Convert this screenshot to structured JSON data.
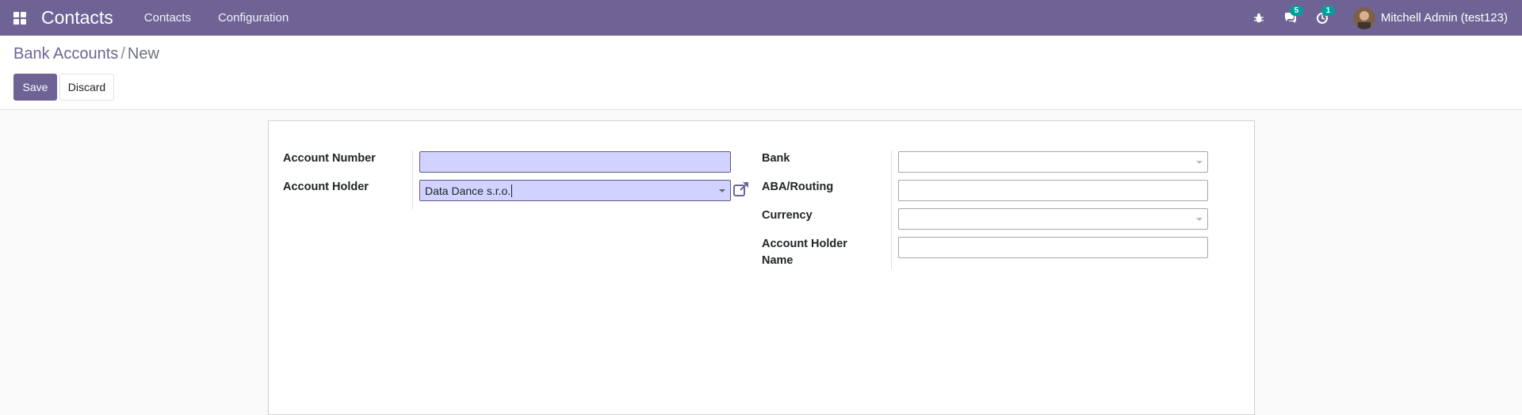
{
  "navbar": {
    "app_name": "Contacts",
    "menu": [
      "Contacts",
      "Configuration"
    ],
    "messages_count": "5",
    "activities_count": "1",
    "user_name": "Mitchell Admin (test123)"
  },
  "breadcrumb": {
    "parent": "Bank Accounts",
    "separator": "/",
    "current": "New"
  },
  "buttons": {
    "save": "Save",
    "discard": "Discard"
  },
  "form": {
    "left": {
      "account_number_label": "Account Number",
      "account_number_value": "",
      "account_holder_label": "Account Holder",
      "account_holder_value": "Data Dance s.r.o."
    },
    "right": {
      "bank_label": "Bank",
      "bank_value": "",
      "aba_label": "ABA/Routing",
      "aba_value": "",
      "currency_label": "Currency",
      "currency_value": "",
      "holder_name_label_line1": "Account Holder",
      "holder_name_label_line2": "Name",
      "holder_name_value": ""
    }
  },
  "colors": {
    "brand": "#6f6396",
    "badge": "#00a09d",
    "required_field": "#d2d2ff"
  }
}
